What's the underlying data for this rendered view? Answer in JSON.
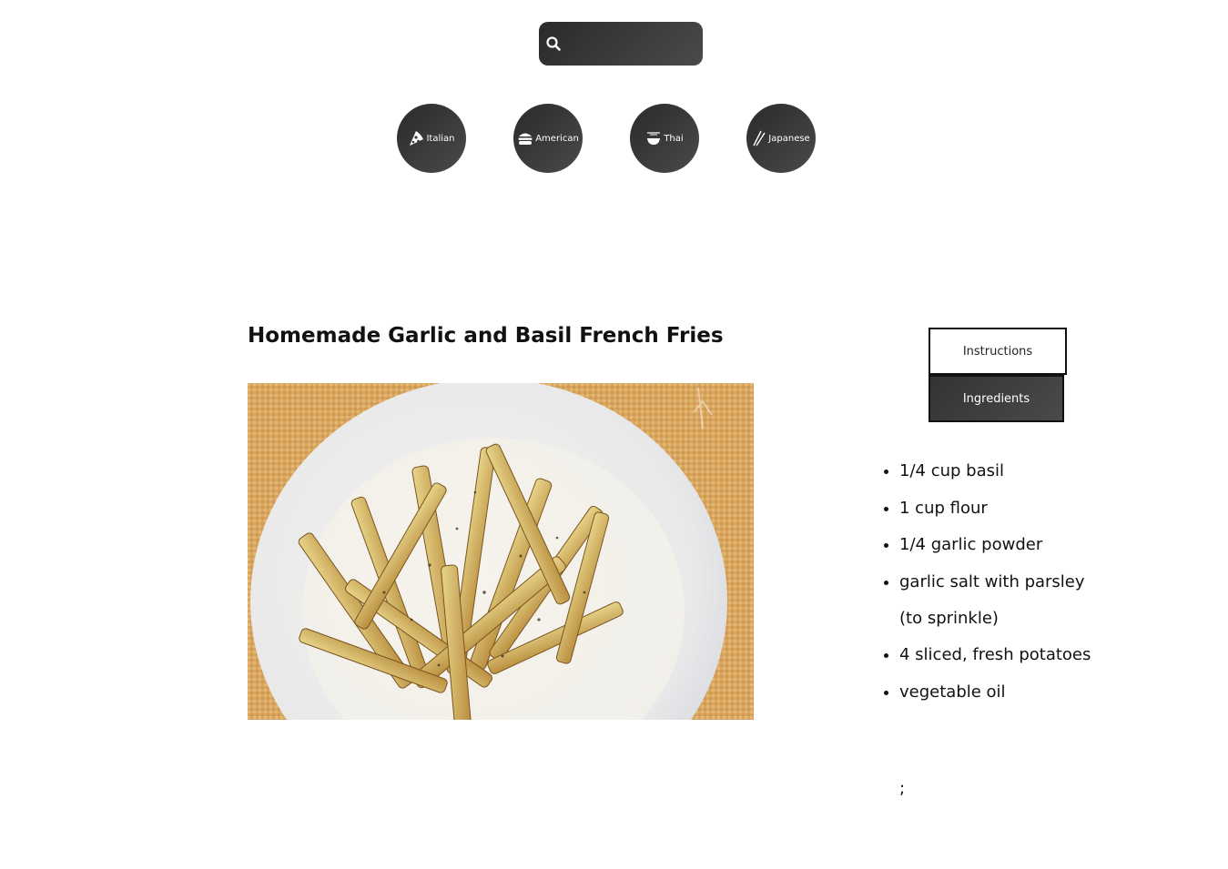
{
  "search": {
    "placeholder": "",
    "value": "",
    "icon": "search-icon"
  },
  "cuisines": [
    {
      "label": "Italian",
      "icon": "pizza-icon"
    },
    {
      "label": "American",
      "icon": "burger-icon"
    },
    {
      "label": "Thai",
      "icon": "noodle-bowl-icon"
    },
    {
      "label": "Japanese",
      "icon": "chopsticks-icon"
    }
  ],
  "recipe": {
    "title": "Homemade Garlic and Basil French Fries",
    "image_alt": "French fries on a white plate"
  },
  "tabs": {
    "instructions": "Instructions",
    "ingredients": "Ingredients"
  },
  "ingredients": [
    "1/4 cup basil",
    "1 cup flour",
    "1/4 garlic powder",
    "garlic salt with parsley (to sprinkle)",
    "4 sliced, fresh potatoes",
    "vegetable oil"
  ],
  "trailing_text": ";",
  "colors": {
    "button_dark": "#3a3a3a",
    "text": "#111111",
    "background": "#ffffff"
  }
}
